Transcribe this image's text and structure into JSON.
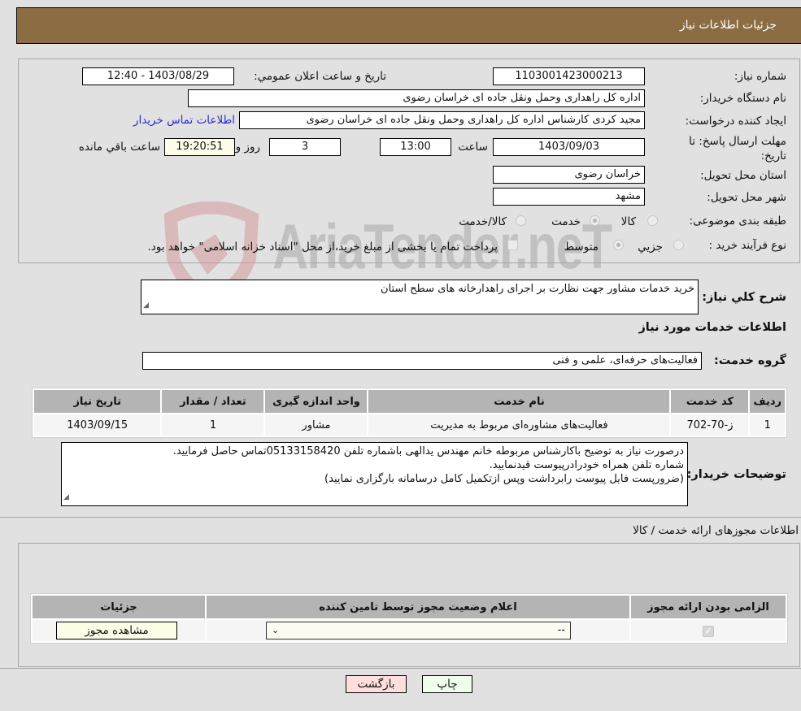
{
  "header": {
    "title": "جزئیات اطلاعات نیاز"
  },
  "form": {
    "need_number_label": "شماره نیاز:",
    "need_number": "1103001423000213",
    "announce_label": "تاریخ و ساعت اعلان عمومي:",
    "announce_value": "1403/08/29 - 12:40",
    "buyer_org_label": "نام دستگاه خریدار:",
    "buyer_org": "اداره کل راهداری وحمل ونقل جاده ای خراسان رضوی",
    "creator_label": "ایجاد کننده درخواست:",
    "creator": "مجید کردی کارشناس اداره کل راهداری وحمل ونقل جاده ای خراسان رضوی",
    "contact_link": "اطلاعات تماس خریدار",
    "deadline_label": "مهلت ارسال پاسخ: تا تاریخ:",
    "deadline_date": "1403/09/03",
    "time_label": "ساعت",
    "deadline_time": "13:00",
    "days_value": "3",
    "days_label": "روز و",
    "remaining_time": "19:20:51",
    "remaining_label": "ساعت باقي مانده",
    "province_label": "استان محل تحویل:",
    "province": "خراسان رضوی",
    "city_label": "شهر محل تحویل:",
    "city": "مشهد",
    "category_label": "طبقه بندی موضوعی:",
    "category_options": [
      {
        "label": "کالا",
        "checked": false
      },
      {
        "label": "خدمت",
        "checked": true
      },
      {
        "label": "کالا/خدمت",
        "checked": false
      }
    ],
    "process_label": "نوع فرآیند خرید :",
    "process_options": [
      {
        "label": "جزیي",
        "checked": false
      },
      {
        "label": "متوسط",
        "checked": true
      }
    ],
    "treasury_note": "پرداخت تمام یا بخشی از مبلغ خرید،از محل \"اسناد خزانه اسلامی\" خواهد بود.",
    "treasury_checked": false
  },
  "watermark": {
    "text": "AriaTender.neT"
  },
  "description": {
    "label": "شرح كلي نياز:",
    "value": "خرید خدمات مشاور جهت نظارت بر اجرای راهدارخانه های سطح استان"
  },
  "services": {
    "section_title": "اطلاعات خدمات مورد نیاز",
    "group_label": "گروه خدمت:",
    "group_value": "فعالیت‌های حرفه‌ای، علمی و فنی",
    "columns": [
      "ردیف",
      "کد خدمت",
      "نام خدمت",
      "واحد اندازه گیری",
      "تعداد / مقدار",
      "تاریخ نیاز"
    ],
    "rows": [
      [
        "1",
        "ز-70-702",
        "فعالیت‌های مشاوره‌ای مربوط به مدیریت",
        "مشاور",
        "1",
        "1403/09/15"
      ]
    ]
  },
  "buyer_notes": {
    "label": "توضیحات خریدار:",
    "lines": [
      "درصورت نیاز به توضیح باکارشناس مربوطه خانم مهندس یدالهی باشماره تلفن 05133158420تماس حاصل فرمایید.",
      "شماره تلفن همراه خودرادرپیوست قیدنمایید.",
      "(ضرورپست فایل پیوست رابرداشت وپس ازتکمیل کامل درسامانه بارگزاری نمایید)"
    ]
  },
  "permits": {
    "section_title": "اطلاعات مجوزهای ارائه خدمت / کالا",
    "columns": [
      "الزامی بودن ارائه مجوز",
      "اعلام وضعیت مجوز توسط تامین کننده",
      "جزئیات"
    ],
    "row": {
      "required_checked": true,
      "status_selected": "--",
      "view_button": "مشاهده مجوز"
    }
  },
  "footer": {
    "print_button": "چاپ",
    "back_button": "بازگشت"
  },
  "colors": {
    "header_bg": "#8c6d43",
    "back_button_bg": "#ffdede",
    "print_button_bg": "#eefeea",
    "link": "#2b2bd6"
  }
}
